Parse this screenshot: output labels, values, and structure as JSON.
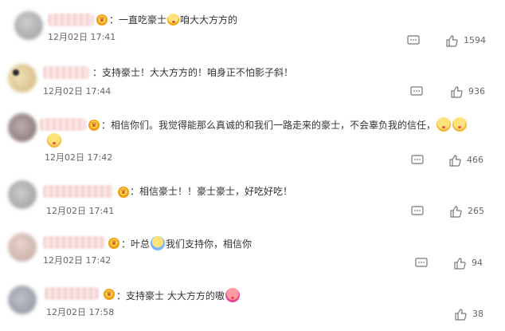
{
  "comments": [
    {
      "separator": "：",
      "parts": [
        {
          "text": "一直吃豪士"
        },
        {
          "emoji": "crying-face-emoji"
        },
        {
          "text": "咱大大方方的"
        }
      ],
      "time": "12月02日 17:41",
      "likes": "1594"
    },
    {
      "separator": "：",
      "parts": [
        {
          "text": "支持豪士！大大方方的！咱身正不怕影子斜！"
        }
      ],
      "time": "12月02日 17:44",
      "likes": "936"
    },
    {
      "separator": "：",
      "parts": [
        {
          "text": "相信你们。我觉得能那么真诚的和我们一路走来的豪士，不会辜负我的信任，"
        },
        {
          "emoji": "kiss-face-emoji"
        },
        {
          "emoji": "kiss-face-emoji"
        }
      ],
      "wrap_parts": [
        {
          "emoji": "kiss-face-emoji"
        }
      ],
      "time": "12月02日 17:42",
      "likes": "466"
    },
    {
      "separator": "：",
      "parts": [
        {
          "text": "相信豪士！！豪士豪士，好吃好吃！"
        }
      ],
      "time": "12月02日 17:41",
      "likes": "265"
    },
    {
      "separator": "：",
      "parts": [
        {
          "text": "叶总"
        },
        {
          "emoji": "tears-face-emoji"
        },
        {
          "text": "我们支持你，相信你"
        }
      ],
      "time": "12月02日 17:42",
      "likes": "94"
    },
    {
      "separator": "：",
      "parts": [
        {
          "text": "支持豪士 大大方方的嗷"
        },
        {
          "emoji": "heart-kiss-emoji"
        }
      ],
      "time": "12月02日 17:58",
      "likes": "38"
    }
  ]
}
